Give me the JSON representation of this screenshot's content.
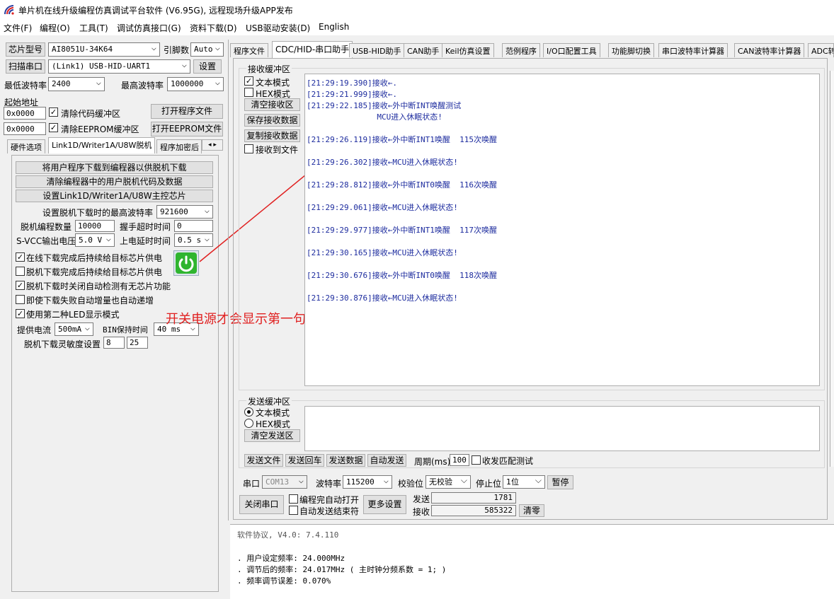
{
  "window": {
    "title": "单片机在线升级编程仿真调试平台软件 (V6.95G), 远程现场升级APP发布"
  },
  "menu": [
    "文件(F)",
    "编程(O)",
    "工具(T)",
    "调试仿真接口(G)",
    "资料下载(D)",
    "USB驱动安装(D)",
    "English"
  ],
  "left": {
    "chip_label": "芯片型号",
    "chip_value": "AI8051U-34K64",
    "pins_label": "引脚数",
    "pins_value": "Auto",
    "scan_button": "扫描串口",
    "port_value": "(Link1) USB-HID-UART1",
    "settings_button": "设置",
    "min_baud_label": "最低波特率",
    "min_baud_value": "2400",
    "max_baud_label": "最高波特率",
    "max_baud_value": "1000000",
    "start_addr_label": "起始地址",
    "addr1": "0x0000",
    "clear_code_label": "清除代码缓冲区",
    "open_prog_button": "打开程序文件",
    "addr2": "0x0000",
    "clear_eeprom_label": "清除EEPROM缓冲区",
    "open_eeprom_button": "打开EEPROM文件",
    "tabs": [
      "硬件选项",
      "Link1D/Writer1A/U8W脱机",
      "程序加密后"
    ],
    "offline": {
      "btn1": "将用户程序下载到编程器以供脱机下载",
      "btn2": "清除编程器中的用户脱机代码及数据",
      "btn3": "设置Link1D/Writer1A/U8W主控芯片",
      "max_baud_label": "设置脱机下载时的最高波特率",
      "max_baud_value": "921600",
      "count_label": "脱机编程数量",
      "count_value": "10000",
      "handshake_label": "握手超时时间",
      "handshake_value": "0",
      "svcc_label": "S-VCC输出电压",
      "svcc_value": "5.0 V",
      "delay_label": "上电延时时间",
      "delay_value": "0.5 s",
      "cb1": "在线下载完成后持续给目标芯片供电",
      "cb2": "脱机下载完成后持续给目标芯片供电",
      "cb3": "脱机下载时关闭自动检测有无芯片功能",
      "cb4": "即使下载失败自动增量也自动递增",
      "cb5": "使用第二种LED显示模式",
      "current_label": "提供电流",
      "current_value": "500mA",
      "bin_label": "BIN保持时间",
      "bin_value": "40 ms",
      "sens_label": "脱机下载灵敏度设置",
      "sens1": "8",
      "sens2": "25"
    }
  },
  "annotation": "开关电源才会显示第一句消息",
  "tabs": [
    "程序文件",
    "CDC/HID-串口助手",
    "USB-HID助手",
    "CAN助手",
    "Keil仿真设置",
    "范例程序",
    "I/O口配置工具",
    "功能脚切换",
    "串口波特率计算器",
    "CAN波特率计算器",
    "ADC转换"
  ],
  "recv": {
    "group_title": "接收缓冲区",
    "text_mode": "文本模式",
    "hex_mode": "HEX模式",
    "clear_button": "清空接收区",
    "save_button": "保存接收数据",
    "copy_button": "复制接收数据",
    "to_file": "接收到文件",
    "lines": [
      "[21:29:19.390]接收←.",
      "[21:29:21.999]接收←.",
      "[21:29:22.185]接收←外中断INT唤醒测试",
      "               MCU进入休眠状态!",
      "[21:29:26.119]接收←外中断INT1唤醒  115次唤醒",
      "[21:29:26.302]接收←MCU进入休眠状态!",
      "[21:29:28.812]接收←外中断INT0唤醒  116次唤醒",
      "[21:29:29.061]接收←MCU进入休眠状态!",
      "[21:29:29.977]接收←外中断INT1唤醒  117次唤醒",
      "[21:29:30.165]接收←MCU进入休眠状态!",
      "[21:29:30.676]接收←外中断INT0唤醒  118次唤醒",
      "[21:29:30.876]接收←MCU进入休眠状态!"
    ]
  },
  "send": {
    "group_title": "发送缓冲区",
    "text_mode": "文本模式",
    "hex_mode": "HEX模式",
    "clear_button": "清空发送区",
    "send_file": "发送文件",
    "send_crlf": "发送回车",
    "send_data": "发送数据",
    "auto_send": "自动发送",
    "period_label": "周期(ms)",
    "period_value": "100",
    "match_label": "收发匹配测试"
  },
  "port": {
    "port_label": "串口",
    "port_value": "COM13",
    "baud_label": "波特率",
    "baud_value": "115200",
    "parity_label": "校验位",
    "parity_value": "无校验",
    "stop_label": "停止位",
    "stop_value": "1位",
    "pause_button": "暂停",
    "close_button": "关闭串口",
    "auto_open": "编程完自动打开",
    "auto_stop": "自动发送结束符",
    "more_button": "更多设置",
    "sent_label": "发送",
    "sent_value": "1781",
    "recv_label": "接收",
    "recv_value": "585322",
    "clear_button": "清零"
  },
  "log": [
    "软件协议, V4.0: 7.4.110",
    ". 用户设定频率: 24.000MHz",
    ". 调节后的频率: 24.017MHz ( 主时钟分频系数 = 1; )",
    ". 频率调节误差: 0.070%"
  ],
  "colors": {
    "recv_text": "#1c2b9e",
    "annotation": "#e02020",
    "power_icon": "#2fb52f"
  }
}
